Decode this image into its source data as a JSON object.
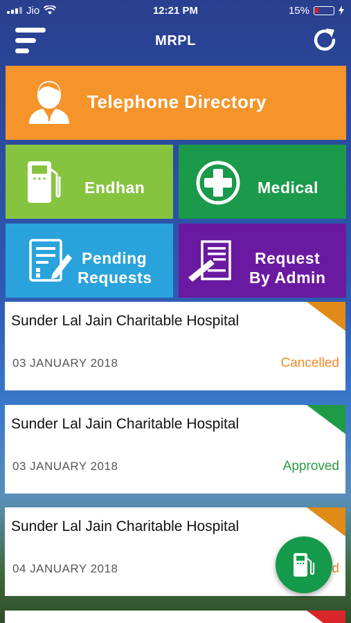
{
  "status_bar": {
    "carrier": "Jio",
    "time": "12:21 PM",
    "battery": "15%"
  },
  "header": {
    "title": "MRPL",
    "menu_icon": "hamburger-menu-icon",
    "refresh_icon": "refresh-icon"
  },
  "tiles": {
    "telephone": {
      "label": "Telephone Directory",
      "icon": "person-icon",
      "color": "#f4942a"
    },
    "endhan": {
      "label": "Endhan",
      "icon": "fuel-pump-icon",
      "color": "#86c440"
    },
    "medical": {
      "label": "Medical",
      "icon": "medical-cross-icon",
      "color": "#1a9a4a"
    },
    "pending": {
      "line1": "Pending",
      "line2": "Requests",
      "icon": "document-edit-icon",
      "color": "#2aa3dc"
    },
    "admin": {
      "line1": "Request",
      "line2": "By Admin",
      "icon": "document-sign-icon",
      "color": "#6a1aa0"
    }
  },
  "requests": [
    {
      "name": "Sunder Lal Jain Charitable Hospital",
      "date": "03 JANUARY  2018",
      "status": "Cancelled",
      "color": "#f08a24"
    },
    {
      "name": "Sunder Lal Jain Charitable Hospital",
      "date": "03 JANUARY  2018",
      "status": "Approved",
      "color": "#2a9a44"
    },
    {
      "name": "Sunder Lal Jain Charitable Hospital",
      "date": "04 JANUARY  2018",
      "status": "d",
      "color": "#f08a24"
    }
  ],
  "fab": {
    "icon": "fuel-pump-icon",
    "color": "#149a4a"
  }
}
